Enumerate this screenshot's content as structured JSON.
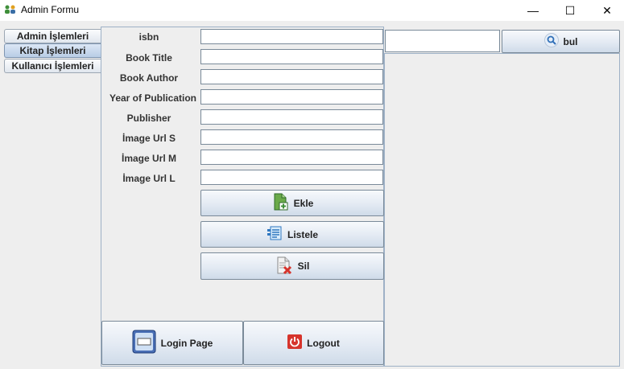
{
  "window": {
    "title": "Admin Formu",
    "minimize_glyph": "—",
    "maximize_glyph": "☐",
    "close_glyph": "✕"
  },
  "tabs": [
    {
      "label": "Admin İşlemleri",
      "selected": false
    },
    {
      "label": "Kitap İşlemleri",
      "selected": true
    },
    {
      "label": "Kullanıcı İşlemleri",
      "selected": false
    }
  ],
  "form": {
    "fields": [
      {
        "label": "isbn",
        "value": ""
      },
      {
        "label": "Book Title",
        "value": ""
      },
      {
        "label": "Book Author",
        "value": ""
      },
      {
        "label": "Year of Publication",
        "value": ""
      },
      {
        "label": "Publisher",
        "value": ""
      },
      {
        "label": "İmage Url S",
        "value": ""
      },
      {
        "label": "İmage Url M",
        "value": ""
      },
      {
        "label": "İmage Url L",
        "value": ""
      }
    ]
  },
  "actions": {
    "add_label": "Ekle",
    "list_label": "Listele",
    "delete_label": "Sil"
  },
  "footer": {
    "login_label": "Login Page",
    "logout_label": "Logout"
  },
  "search": {
    "value": "",
    "button_label": "bul"
  },
  "colors": {
    "accent": "#3a6ea5",
    "logout_red": "#d6342c",
    "add_green": "#3f8f3a"
  },
  "icons": {
    "app": "users-icon",
    "search": "magnifier-icon",
    "add": "document-add-icon",
    "list": "list-icon",
    "delete": "document-delete-icon",
    "login": "window-icon",
    "logout": "power-icon"
  }
}
